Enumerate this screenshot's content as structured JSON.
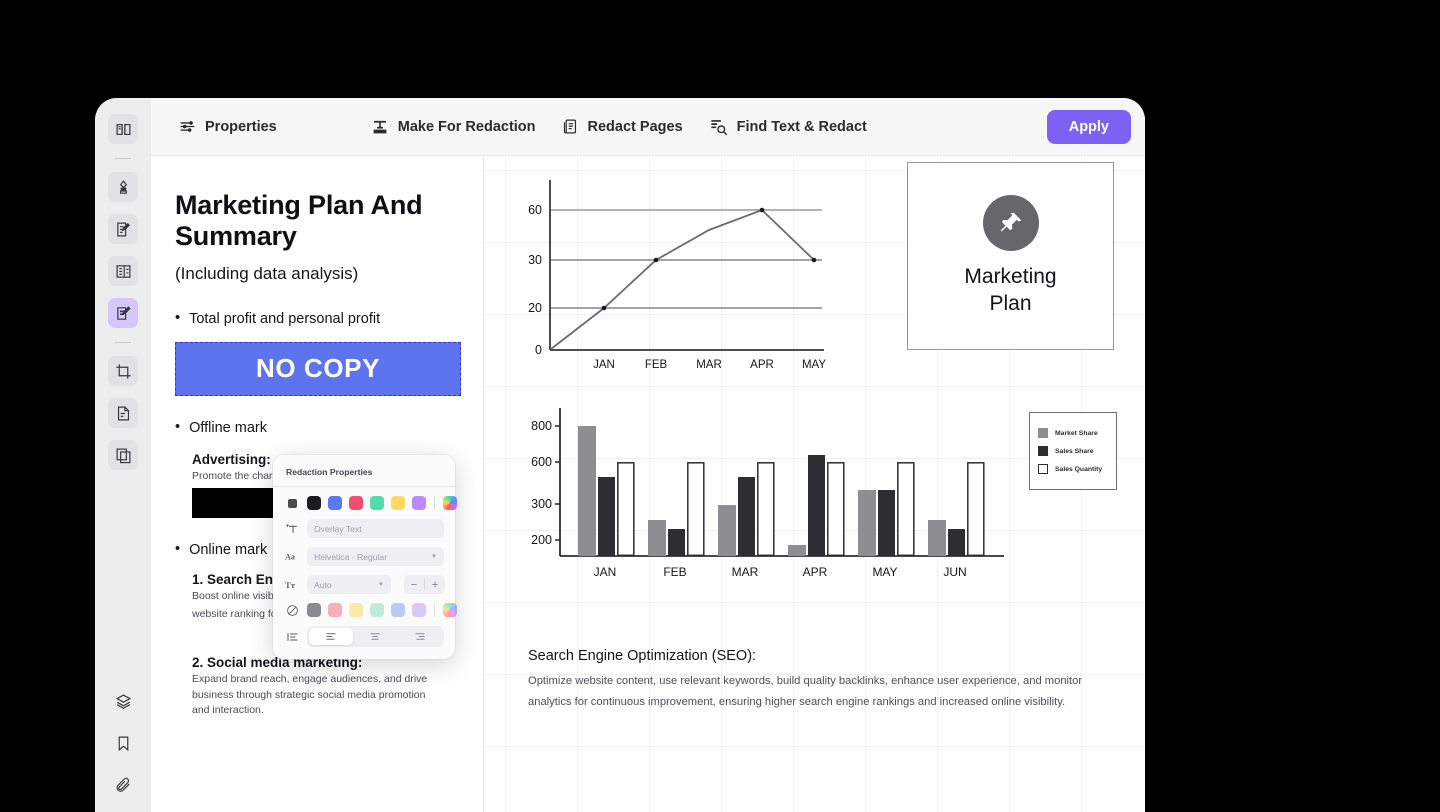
{
  "toolbar": {
    "items": [
      {
        "label": "Properties",
        "icon": "sliders-icon"
      },
      {
        "label": "Make For Redaction",
        "icon": "mark-text-icon"
      },
      {
        "label": "Redact Pages",
        "icon": "document-pages-icon"
      },
      {
        "label": "Find Text & Redact",
        "icon": "find-text-icon"
      }
    ],
    "apply_label": "Apply",
    "accent_color": "#7b61f4"
  },
  "sidebar": {
    "items": [
      {
        "name": "sidebar-item-read",
        "icon": "book-open-icon",
        "active": false
      },
      {
        "name": "sidebar-item-highlight",
        "icon": "marker-pen-icon",
        "active": false
      },
      {
        "name": "sidebar-item-annotate",
        "icon": "edit-document-icon",
        "active": false
      },
      {
        "name": "sidebar-item-form",
        "icon": "form-fields-icon",
        "active": false
      },
      {
        "name": "sidebar-item-redact",
        "icon": "redact-edit-icon",
        "active": true
      },
      {
        "name": "sidebar-item-crop",
        "icon": "crop-icon",
        "active": false
      },
      {
        "name": "sidebar-item-extract-page",
        "icon": "page-extract-icon",
        "active": false
      },
      {
        "name": "sidebar-item-organize-pages",
        "icon": "pages-stack-icon",
        "active": false
      },
      {
        "name": "sidebar-item-layers",
        "icon": "layers-icon",
        "active": false
      },
      {
        "name": "sidebar-item-bookmarks",
        "icon": "bookmark-icon",
        "active": false
      },
      {
        "name": "sidebar-item-attachments",
        "icon": "paperclip-icon",
        "active": false
      }
    ]
  },
  "document": {
    "title": "Marketing Plan And Summary",
    "subtitle": "(Including data analysis)",
    "bullet_1": "Total profit and personal profit",
    "redaction_label": "NO COPY",
    "redaction_fill": "#5e74ee",
    "bullet_2": "Offline mark",
    "advertising_head": "Advertising:",
    "advertising_body": "Promote the char",
    "bullet_3": "Online mark",
    "item_1_head": "1. Search Engi",
    "item_1_body_line1": "Boost online visibi",
    "item_1_body_line2": "website ranking fo",
    "item_2_head": "2. Social media marketing:",
    "item_2_body": "Expand brand reach, engage audiences, and drive business through strategic social media promotion and interaction."
  },
  "popup": {
    "title": "Redaction Properties",
    "fill_swatches": [
      "#4a4a50",
      "#1c1c1e",
      "#5b79f0",
      "#ee4f6e",
      "#52dcae",
      "#ffd964",
      "#bb8cf7"
    ],
    "selected_fill_index": 1,
    "rainbow_label": "custom-color",
    "overlay_text_placeholder": "Overlay Text",
    "font_value": "Helvetica · Regular",
    "size_value": "Auto",
    "text_swatches": [
      "#8a8a90",
      "#f6aebb",
      "#fbe9a8",
      "#bfecd9",
      "#bacbf3",
      "#d9c9f6"
    ],
    "selected_text_index": 0,
    "align_options": [
      "align-left",
      "align-center",
      "align-right"
    ],
    "selected_align_index": 0,
    "stepper_minus": "−",
    "stepper_plus": "+"
  },
  "right_page": {
    "card_label_line1": "Marketing",
    "card_label_line2": "Plan",
    "card_icon": "pushpin-icon",
    "seo_title": "Search Engine Optimization (SEO):",
    "seo_body": "Optimize website content, use relevant keywords, build quality backlinks, enhance user experience, and monitor analytics for continuous improvement, ensuring higher search engine rankings and increased online visibility."
  },
  "chart_data": [
    {
      "type": "line",
      "title": "",
      "categories": [
        "JAN",
        "FEB",
        "MAR",
        "APR",
        "MAY"
      ],
      "series": [
        {
          "name": "Trend",
          "values": [
            20,
            30,
            45,
            60,
            30
          ]
        }
      ],
      "origin_value": 0,
      "ytick_labels": [
        "0",
        "20",
        "30",
        "60"
      ],
      "ytick_values": [
        0,
        20,
        30,
        60
      ],
      "ylim": [
        0,
        68
      ],
      "xlabel": "",
      "ylabel": "",
      "grid": true,
      "legend": "none",
      "area_fill": "gradient-gray"
    },
    {
      "type": "bar",
      "title": "",
      "categories": [
        "JAN",
        "FEB",
        "MAR",
        "APR",
        "MAY",
        "JUN"
      ],
      "series": [
        {
          "name": "Market Share",
          "color": "#8e8e92",
          "values": [
            800,
            255,
            295,
            175,
            400,
            255
          ]
        },
        {
          "name": "Sales Share",
          "color": "#2e2e32",
          "values": [
            430,
            230,
            430,
            645,
            400,
            230
          ]
        },
        {
          "name": "Sales Quantity",
          "color": "#ffffff",
          "values": [
            600,
            600,
            600,
            600,
            600,
            600
          ]
        }
      ],
      "ytick_labels": [
        "200",
        "300",
        "600",
        "800"
      ],
      "ytick_values": [
        200,
        300,
        600,
        800
      ],
      "ylim": [
        130,
        860
      ],
      "xlabel": "",
      "ylabel": "",
      "grid": true,
      "legend": "right"
    }
  ]
}
